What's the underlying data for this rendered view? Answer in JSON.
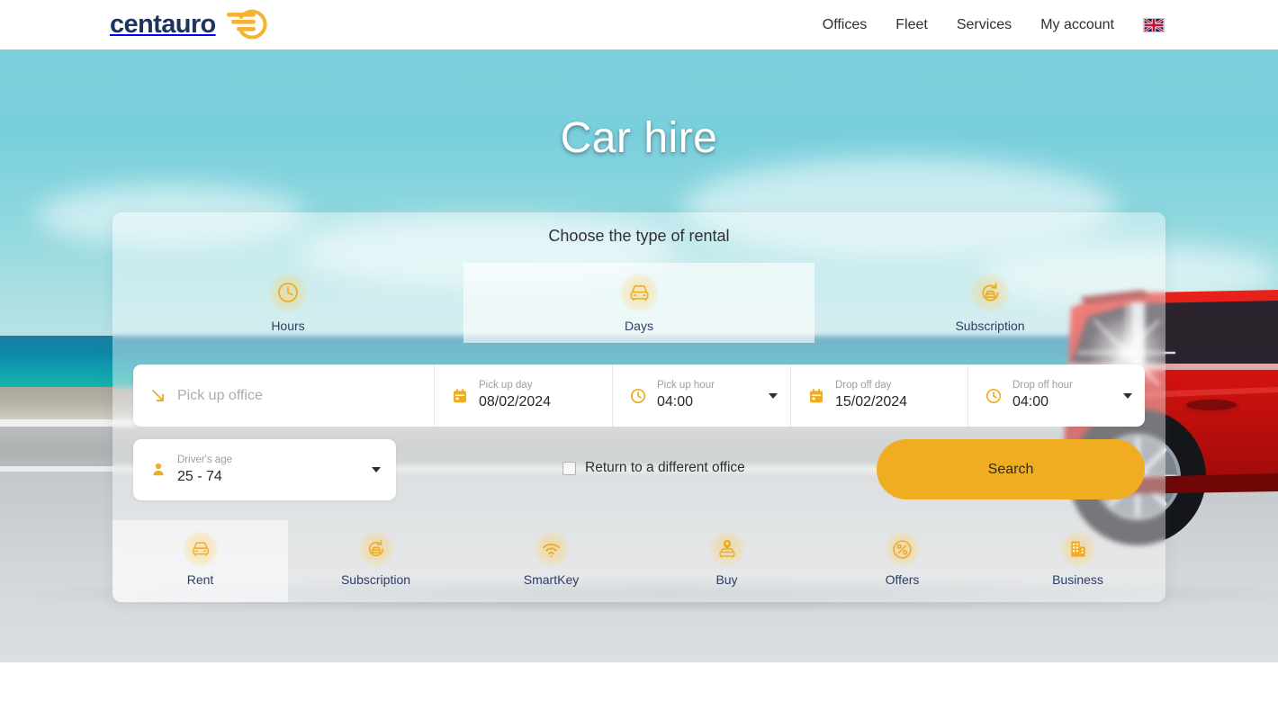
{
  "header": {
    "logo_text": "centauro",
    "nav": [
      {
        "label": "Offices"
      },
      {
        "label": "Fleet"
      },
      {
        "label": "Services"
      },
      {
        "label": "My account"
      }
    ],
    "language_flag": "uk-flag-icon"
  },
  "hero": {
    "title": "Car hire"
  },
  "booking": {
    "panel_title": "Choose the type of rental",
    "rental_types": [
      {
        "label": "Hours",
        "icon": "clock-icon",
        "active": false
      },
      {
        "label": "Days",
        "icon": "car-front-icon",
        "active": true
      },
      {
        "label": "Subscription",
        "icon": "subscription-refresh-car-icon",
        "active": false
      }
    ],
    "fields": {
      "pickup_office": {
        "placeholder": "Pick up office",
        "value": "",
        "icon": "arrow-down-right-icon"
      },
      "pickup_day": {
        "label": "Pick up day",
        "value": "08/02/2024",
        "icon": "calendar-icon"
      },
      "pickup_hour": {
        "label": "Pick up hour",
        "value": "04:00",
        "icon": "clock-icon"
      },
      "dropoff_day": {
        "label": "Drop off day",
        "value": "15/02/2024",
        "icon": "calendar-icon"
      },
      "dropoff_hour": {
        "label": "Drop off hour",
        "value": "04:00",
        "icon": "clock-icon"
      },
      "drivers_age": {
        "label": "Driver's age",
        "value": "25 - 74",
        "icon": "person-icon"
      }
    },
    "return_different_office": {
      "label": "Return to a different office",
      "checked": false
    },
    "search_label": "Search"
  },
  "services": [
    {
      "label": "Rent",
      "icon": "car-front-icon",
      "active": true
    },
    {
      "label": "Subscription",
      "icon": "subscription-refresh-car-icon",
      "active": false
    },
    {
      "label": "SmartKey",
      "icon": "wifi-icon",
      "active": false
    },
    {
      "label": "Buy",
      "icon": "car-pin-icon",
      "active": false
    },
    {
      "label": "Offers",
      "icon": "percent-circle-icon",
      "active": false
    },
    {
      "label": "Business",
      "icon": "building-icon",
      "active": false
    }
  ],
  "colors": {
    "brand_yellow": "#f0ad22",
    "brand_navy": "#1d3461",
    "accent_text": "#2d3e66"
  }
}
